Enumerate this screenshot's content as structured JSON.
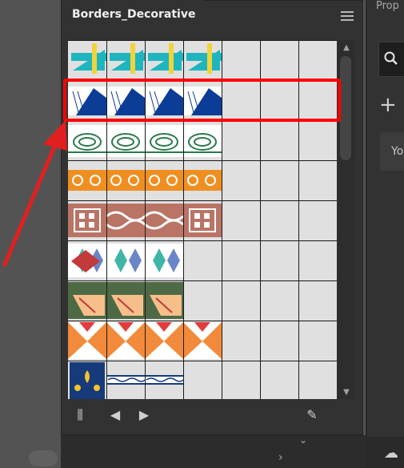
{
  "panel": {
    "title": "Borders_Decorative"
  },
  "properties": {
    "tab_label": "Prop",
    "card_text": "Yo",
    "plus_glyph": "+"
  },
  "glyphs": {
    "scroll_up": "▲",
    "scroll_down": "▼",
    "prev": "◀",
    "next": "▶",
    "library": "⫼",
    "brush_off": "✎",
    "chevron_right": "›",
    "chevron_down": "⌄",
    "cloud": "☁"
  },
  "swatch_rows": [
    {
      "name": "row-1-cyan-yellow",
      "colors": [
        "#1fb5bf",
        "#f1d33a"
      ]
    },
    {
      "name": "row-2-blue-chevron",
      "colors": [
        "#0b3c96",
        "#ffffff"
      ],
      "selected": true
    },
    {
      "name": "row-3-green-swirl",
      "colors": [
        "#2c7a4d",
        "#ffffff"
      ]
    },
    {
      "name": "row-4-orange-scroll",
      "colors": [
        "#ef8f22",
        "#ffffff"
      ]
    },
    {
      "name": "row-5-rope-squares",
      "colors": [
        "#b97466",
        "#ffffff"
      ]
    },
    {
      "name": "row-6-diamonds",
      "colors": [
        "#c23a3a",
        "#3fb6a5",
        "#6a86c8"
      ]
    },
    {
      "name": "row-7-green-peach",
      "colors": [
        "#4d6a45",
        "#f6bf8a",
        "#c0393b"
      ]
    },
    {
      "name": "row-8-orange-red",
      "colors": [
        "#f28a3b",
        "#e43c3c"
      ]
    },
    {
      "name": "row-9-navy-yellow",
      "colors": [
        "#173a7a",
        "#f2c32c"
      ]
    }
  ],
  "colors": {
    "highlight": "#ff0000",
    "arrow": "#e21f1f",
    "grid_bg": "#e0e0e0",
    "grid_line": "#1a1a1a"
  }
}
